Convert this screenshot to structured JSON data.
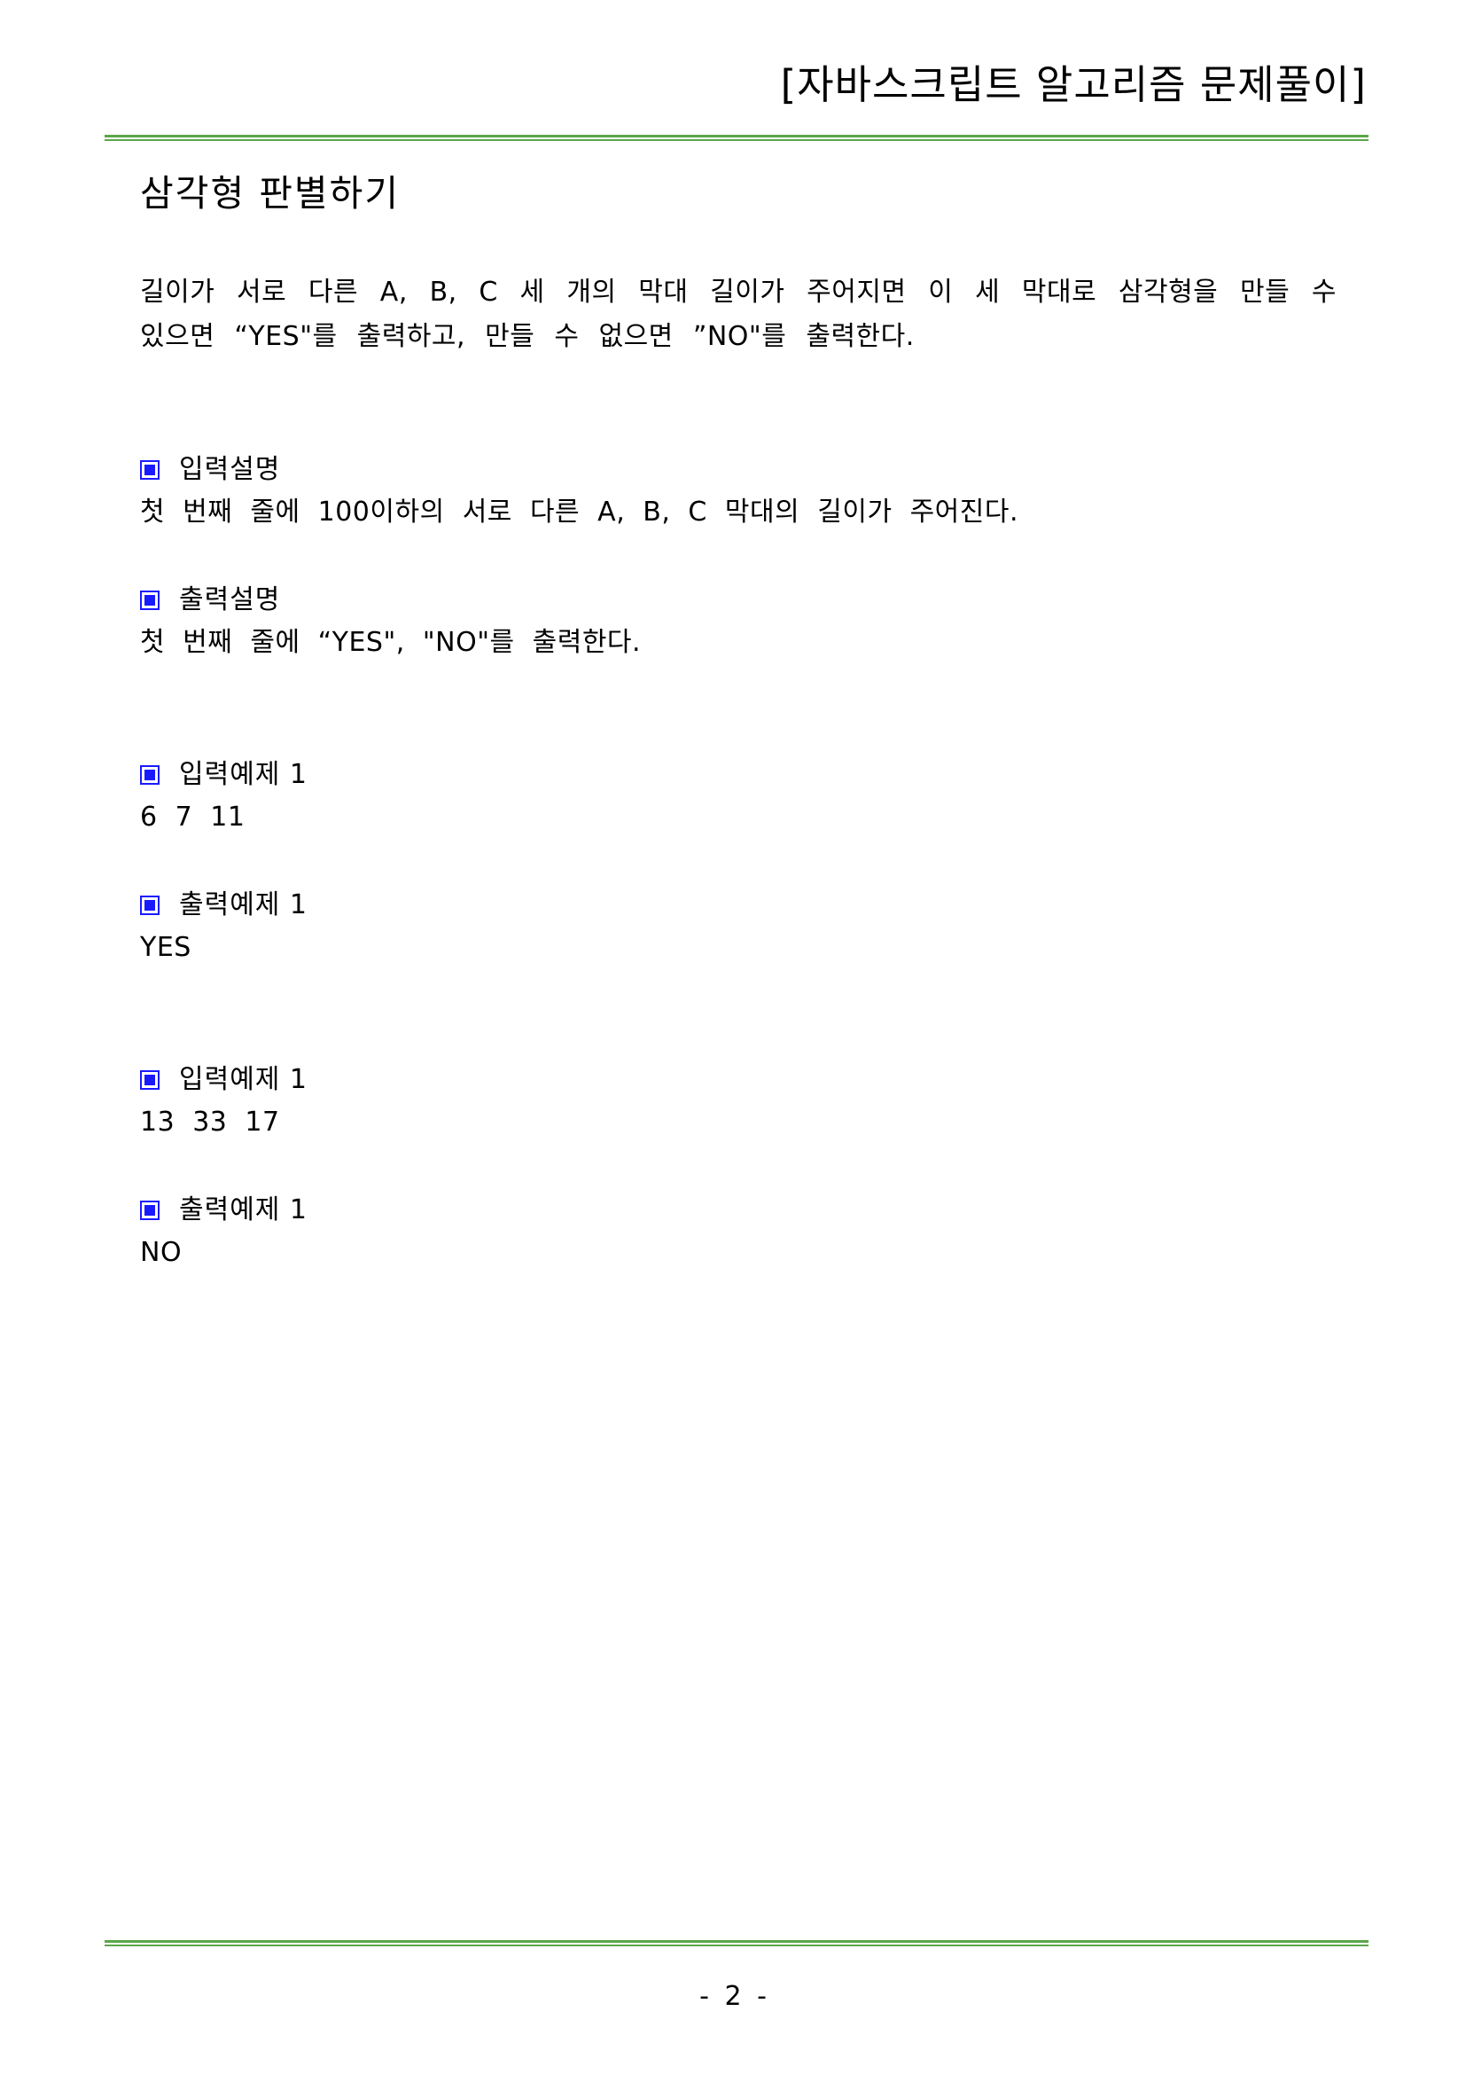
{
  "header": {
    "title": "[자바스크립트 알고리즘 문제풀이]"
  },
  "problem": {
    "title": "삼각형 판별하기",
    "description": "길이가 서로 다른 A, B, C 세 개의 막대 길이가 주어지면 이 세 막대로 삼각형을 만들 수 있으면 “YES\"를 출력하고, 만들 수 없으면 ”NO\"를 출력한다."
  },
  "sections": [
    {
      "label": "입력설명",
      "text": "첫 번째 줄에 100이하의 서로 다른 A, B, C 막대의 길이가 주어진다."
    },
    {
      "label": "출력설명",
      "text": "첫 번째 줄에 “YES\", \"NO\"를 출력한다."
    },
    {
      "label": "입력예제 1",
      "text": "6 7 11"
    },
    {
      "label": "출력예제 1",
      "text": "YES"
    },
    {
      "label": "입력예제 1",
      "text": "13 33 17"
    },
    {
      "label": "출력예제 1",
      "text": "NO"
    }
  ],
  "footer": {
    "page_number": "- 2 -"
  },
  "colors": {
    "rule": "#5ca64a",
    "bullet": "#1a1aff"
  },
  "icons": {
    "section_bullet": "square-bullet-icon"
  }
}
